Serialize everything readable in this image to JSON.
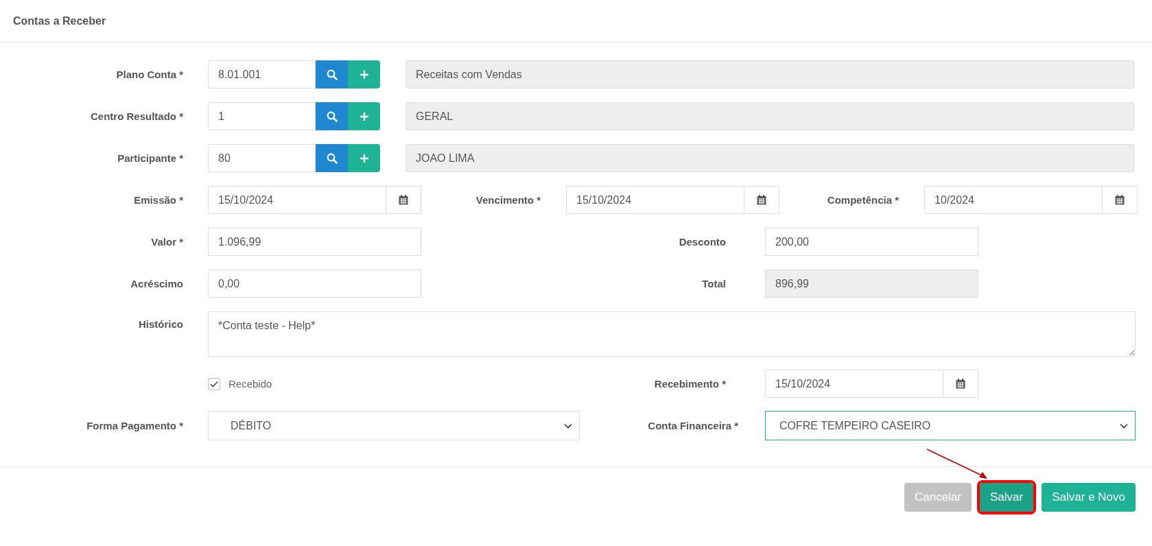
{
  "dialog": {
    "title": "Contas a Receber"
  },
  "lookup_rows": [
    {
      "label": "Plano Conta *",
      "code": "8.01.001",
      "description": "Receitas com Vendas"
    },
    {
      "label": "Centro Resultado *",
      "code": "1",
      "description": "GERAL"
    },
    {
      "label": "Participante *",
      "code": "80",
      "description": "JOAO LIMA"
    }
  ],
  "date_fields": [
    {
      "label": "Emissão *",
      "value": "15/10/2024"
    },
    {
      "label": "Vencimento *",
      "value": "15/10/2024"
    },
    {
      "label": "Competência *",
      "value": "10/2024"
    }
  ],
  "amount_rows": [
    {
      "left": {
        "label": "Valor *",
        "value": "1.096,99",
        "readonly": false
      },
      "right": {
        "label": "Desconto",
        "value": "200,00",
        "readonly": false
      }
    },
    {
      "left": {
        "label": "Acréscimo",
        "value": "0,00",
        "readonly": false
      },
      "right": {
        "label": "Total",
        "value": "896,99",
        "readonly": true
      }
    }
  ],
  "historico": {
    "label": "Histórico",
    "value": "*Conta teste - Help*"
  },
  "recebido": {
    "label": "Recebido",
    "checked": true
  },
  "recebimento": {
    "label": "Recebimento *",
    "value": "15/10/2024"
  },
  "selects": [
    {
      "label": "Forma Pagamento *",
      "value": "DÉBITO",
      "focused": false
    },
    {
      "label": "Conta Financeira *",
      "value": "COFRE TEMPEIRO CASEIRO",
      "focused": true
    }
  ],
  "buttons": [
    {
      "label": "Cancelar",
      "kind": "cancel",
      "highlighted": false
    },
    {
      "label": "Salvar",
      "kind": "primary",
      "highlighted": true
    },
    {
      "label": "Salvar e Novo",
      "kind": "primary",
      "highlighted": false
    }
  ]
}
